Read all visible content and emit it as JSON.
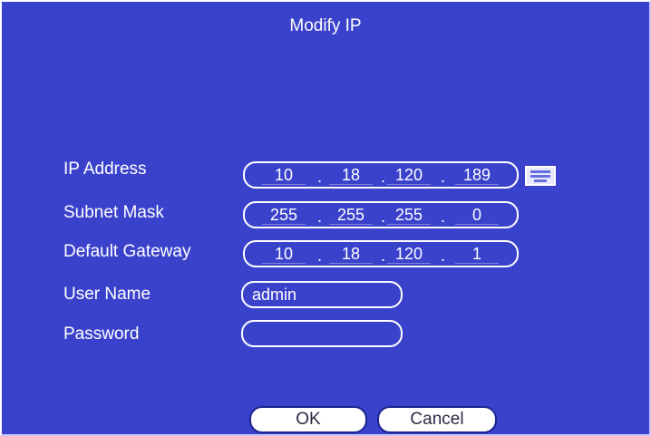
{
  "dialog": {
    "title": "Modify IP"
  },
  "fields": {
    "ip_address": {
      "label": "IP Address",
      "octets": [
        "10",
        "18",
        "120",
        "189"
      ],
      "separator": "."
    },
    "subnet_mask": {
      "label": "Subnet Mask",
      "octets": [
        "255",
        "255",
        "255",
        "0"
      ],
      "separator": "."
    },
    "default_gateway": {
      "label": "Default Gateway",
      "octets": [
        "10",
        "18",
        "120",
        "1"
      ],
      "separator": "."
    },
    "user_name": {
      "label": "User Name",
      "value": "admin"
    },
    "password": {
      "label": "Password",
      "value": ""
    }
  },
  "keyboard_icon": "keyboard-icon",
  "buttons": {
    "ok_label": "OK",
    "cancel_label": "Cancel"
  },
  "colors": {
    "background": "#3a42cc",
    "text": "#ffffff",
    "button_bg": "#ffffff"
  }
}
